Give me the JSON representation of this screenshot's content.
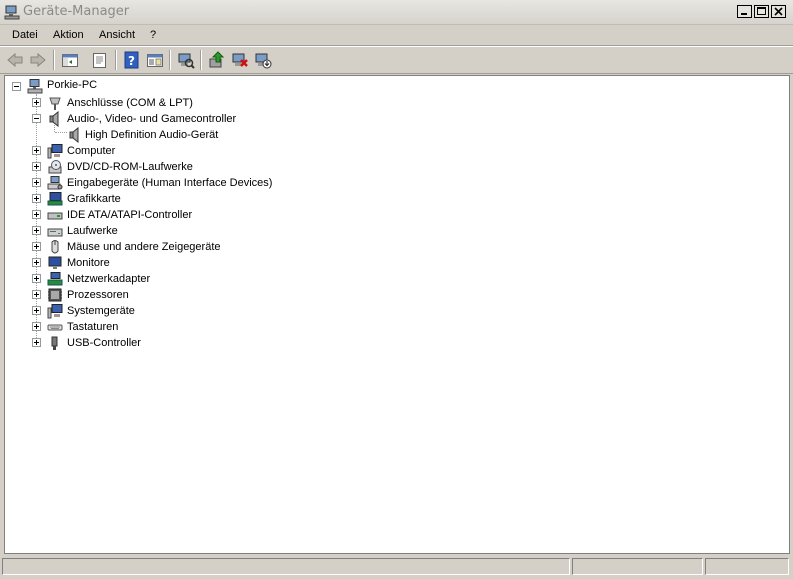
{
  "window": {
    "title": "Geräte-Manager",
    "icon": "device-manager-icon"
  },
  "window_controls": [
    "minimize-icon",
    "maximize-icon",
    "close-icon"
  ],
  "menu": {
    "file": "Datei",
    "action": "Aktion",
    "view": "Ansicht",
    "help": "?"
  },
  "toolbar": {
    "icons": [
      "back-arrow-icon",
      "forward-arrow-icon",
      "show-hide-console-tree-icon",
      "properties-icon",
      "help-icon",
      "details-view-icon",
      "scan-hardware-icon",
      "update-driver-icon",
      "uninstall-icon",
      "disable-device-icon"
    ]
  },
  "tree": {
    "root": {
      "label": "Porkie-PC",
      "icon": "computer-network-icon"
    },
    "categories": [
      {
        "label": "Anschlüsse (COM & LPT)",
        "icon": "port-icon",
        "expanded": false
      },
      {
        "label": "Audio-, Video- und Gamecontroller",
        "icon": "speaker-icon",
        "expanded": true,
        "children": [
          {
            "label": "High Definition Audio-Gerät",
            "icon": "speaker-icon"
          }
        ]
      },
      {
        "label": "Computer",
        "icon": "computer-icon",
        "expanded": false
      },
      {
        "label": "DVD/CD-ROM-Laufwerke",
        "icon": "cd-drive-icon",
        "expanded": false
      },
      {
        "label": "Eingabegeräte (Human Interface Devices)",
        "icon": "hid-icon",
        "expanded": false
      },
      {
        "label": "Grafikkarte",
        "icon": "display-adapter-icon",
        "expanded": false
      },
      {
        "label": "IDE ATA/ATAPI-Controller",
        "icon": "ide-controller-icon",
        "expanded": false
      },
      {
        "label": "Laufwerke",
        "icon": "disk-drive-icon",
        "expanded": false
      },
      {
        "label": "Mäuse und andere Zeigegeräte",
        "icon": "mouse-icon",
        "expanded": false
      },
      {
        "label": "Monitore",
        "icon": "monitor-icon",
        "expanded": false
      },
      {
        "label": "Netzwerkadapter",
        "icon": "network-adapter-icon",
        "expanded": false
      },
      {
        "label": "Prozessoren",
        "icon": "processor-icon",
        "expanded": false
      },
      {
        "label": "Systemgeräte",
        "icon": "system-devices-icon",
        "expanded": false
      },
      {
        "label": "Tastaturen",
        "icon": "keyboard-icon",
        "expanded": false
      },
      {
        "label": "USB-Controller",
        "icon": "usb-icon",
        "expanded": false
      }
    ]
  },
  "status_bar": {
    "panes": [
      "",
      "",
      ""
    ]
  },
  "colors": {
    "chrome": "#d4d0c8",
    "tree_background": "#ffffff",
    "title_text": "#8c8a86"
  }
}
